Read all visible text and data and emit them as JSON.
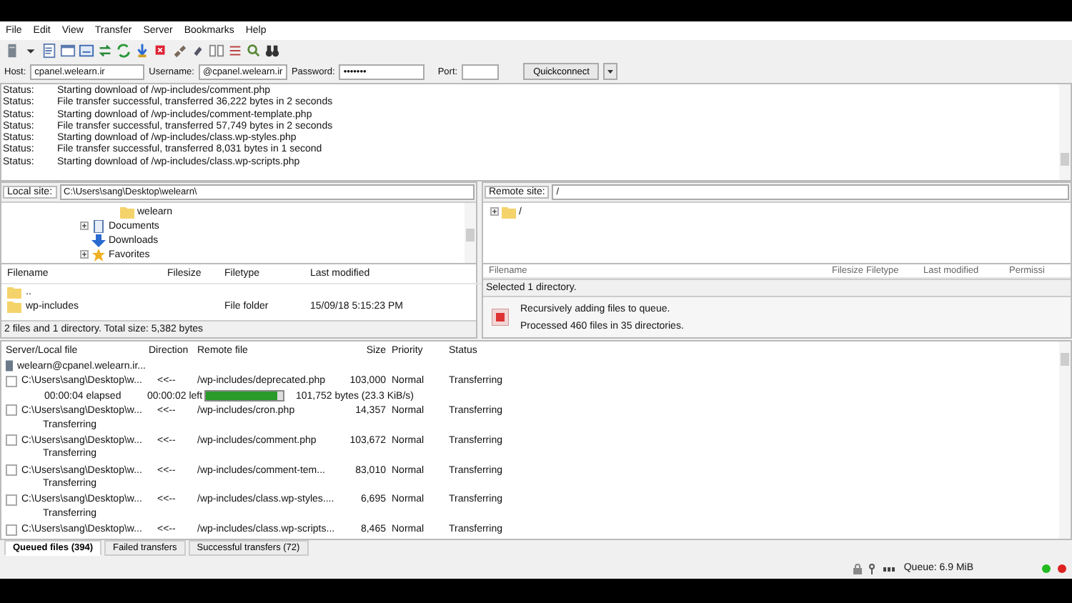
{
  "menu": [
    "File",
    "Edit",
    "View",
    "Transfer",
    "Server",
    "Bookmarks",
    "Help"
  ],
  "quickconnect": {
    "host_label": "Host:",
    "host": "cpanel.welearn.ir",
    "username_label": "Username:",
    "username": "@cpanel.welearn.ir",
    "password_label": "Password:",
    "password": "•••••••",
    "port_label": "Port:",
    "button": "Quickconnect"
  },
  "log": [
    {
      "label": "Status:",
      "message": "Starting download of /wp-includes/comment.php"
    },
    {
      "label": "Status:",
      "message": "File transfer successful, transferred 36,222 bytes in 2 seconds"
    },
    {
      "label": "Status:",
      "message": "Starting download of /wp-includes/comment-template.php"
    },
    {
      "label": "Status:",
      "message": "File transfer successful, transferred 57,749 bytes in 2 seconds"
    },
    {
      "label": "Status:",
      "message": "Starting download of /wp-includes/class.wp-styles.php"
    },
    {
      "label": "Status:",
      "message": "File transfer successful, transferred 8,031 bytes in 1 second"
    },
    {
      "label": "Status:",
      "message": "Starting download of /wp-includes/class.wp-scripts.php"
    }
  ],
  "local": {
    "label": "Local site:",
    "path": "C:\\Users\\sang\\Desktop\\welearn\\",
    "tree": [
      {
        "kind": "group",
        "children": [
          {
            "label": "welearn",
            "kind": "folder"
          }
        ]
      },
      {
        "label": "Documents",
        "kind": "documents",
        "expanded": false
      },
      {
        "label": "Downloads",
        "kind": "downloads"
      },
      {
        "label": "Favorites",
        "kind": "favorites",
        "expanded": false
      }
    ],
    "columns": [
      "Filename",
      "Filesize",
      "Filetype",
      "Last modified"
    ],
    "rows": [
      {
        "name": ".."
      },
      {
        "name": "wp-includes",
        "filetype": "File folder",
        "modified": "15/09/18 5:15:23 PM"
      }
    ],
    "status": "2 files and 1 directory. Total size: 5,382 bytes"
  },
  "remote": {
    "label": "Remote site:",
    "path": "/",
    "tree": [
      {
        "label": "/",
        "kind": "folder",
        "expanded": false
      }
    ],
    "columns": [
      "Filename",
      "Filesize",
      "Filetype",
      "Last modified",
      "Permissi"
    ],
    "status": "Selected 1 directory.",
    "dialog": [
      "Recursively adding files to queue.",
      "Processed 460 files in 35 directories."
    ]
  },
  "queue": {
    "columns": [
      "Server/Local file",
      "Direction",
      "Remote file",
      "Size",
      "Priority",
      "Status"
    ],
    "server": "welearn@cpanel.welearn.ir...",
    "items": [
      {
        "checked": false,
        "local": "C:\\Users\\sang\\Desktop\\w...",
        "direction": "<<--",
        "remote": "/wp-includes/deprecated.php",
        "size": "103,000",
        "priority": "Normal",
        "status": "Transferring",
        "progress": {
          "elapsed": "00:00:04 elapsed",
          "left": "00:00:02 left",
          "level": 0.93,
          "bytes": "101,752 bytes (23.3 KiB/s)"
        }
      },
      {
        "local": "C:\\Users\\sang\\Desktop\\w...",
        "direction": "<<--",
        "checked": false,
        "remote": "/wp-includes/cron.php",
        "size": "14,357",
        "priority": "Normal",
        "status": "Transferring",
        "sub_status": "Transferring"
      },
      {
        "local": "C:\\Users\\sang\\Desktop\\w...",
        "direction": "<<--",
        "checked": false,
        "remote": "/wp-includes/comment.php",
        "size": "103,672",
        "priority": "Normal",
        "status": "Transferring",
        "sub_status": "Transferring"
      },
      {
        "local": "C:\\Users\\sang\\Desktop\\w...",
        "direction": "<<--",
        "checked": false,
        "remote": "/wp-includes/comment-tem...",
        "size": "83,010",
        "priority": "Normal",
        "status": "Transferring",
        "sub_status": "Transferring"
      },
      {
        "local": "C:\\Users\\sang\\Desktop\\w...",
        "direction": "<<--",
        "checked": false,
        "remote": "/wp-includes/class.wp-styles....",
        "size": "6,695",
        "priority": "Normal",
        "status": "Transferring",
        "sub_status": "Transferring"
      },
      {
        "local": "C:\\Users\\sang\\Desktop\\w...",
        "direction": "<<--",
        "checked": false,
        "remote": "/wp-includes/class.wp-scripts...",
        "size": "8,465",
        "priority": "Normal",
        "status": "Transferring"
      }
    ]
  },
  "tabs": [
    {
      "label": "Queued files (394)",
      "selected": true
    },
    {
      "label": "Failed transfers",
      "selected": false
    },
    {
      "label": "Successful transfers (72)",
      "selected": false
    }
  ],
  "status_bar": {
    "queue": "Queue: 6.9 MiB"
  }
}
